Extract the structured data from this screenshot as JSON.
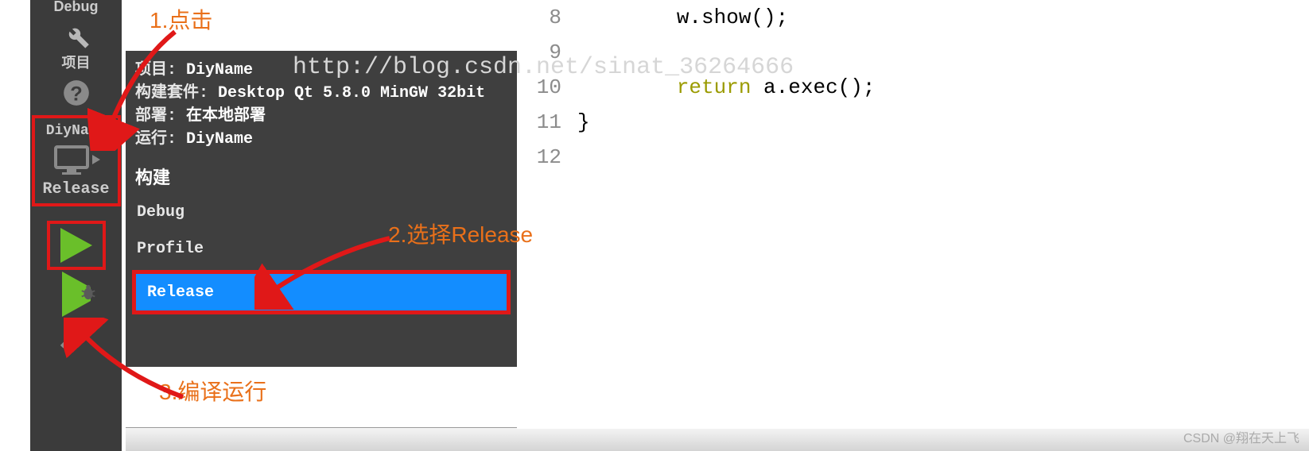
{
  "sidebar": {
    "debug_label": "Debug",
    "project_label": "项目",
    "help_label": "帮助",
    "target": {
      "name": "DiyName",
      "config": "Release"
    }
  },
  "popup": {
    "rows": {
      "project_lbl": "项目:",
      "project_val": " DiyName",
      "kit_lbl": "构建套件:",
      "kit_val": " Desktop Qt 5.8.0 MinGW 32bit",
      "deploy_lbl": "部署:",
      "deploy_val": " 在本地部署",
      "run_lbl": "运行:",
      "run_val": " DiyName"
    },
    "section": "构建",
    "configs": [
      "Debug",
      "Profile",
      "Release"
    ],
    "selected": "Release"
  },
  "code": {
    "lines": [
      8,
      9,
      10,
      11,
      12
    ],
    "l8_indent": "        ",
    "l8_call": "w.show();",
    "l10_indent": "        ",
    "l10_kw": "return",
    "l10_rest": " a.exec();",
    "l11": "}"
  },
  "annotations": {
    "a1": "1.点击",
    "a2": "2.选择Release",
    "a3": "3.编译运行"
  },
  "watermark": "http://blog.csdn.net/sinat_36264666",
  "credit": "CSDN @翔在天上飞"
}
